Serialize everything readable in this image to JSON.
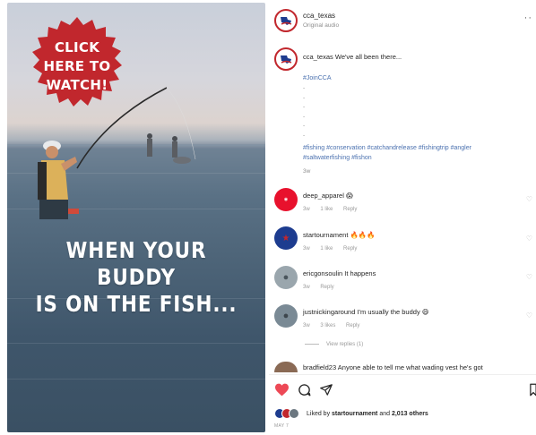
{
  "post": {
    "account": "cca_texas",
    "audio": "Original audio",
    "caption_user": "cca_texas",
    "caption_text": "We've all been there...",
    "hashtag_join": "#JoinCCA",
    "caption_dots": [
      "-",
      "-",
      "-",
      "-",
      "-",
      "-"
    ],
    "hashtags_line1": "#fishing #conservation #catchandrelease #fishingtrip #angler",
    "hashtags_line2": "#saltwaterfishing #fishon",
    "caption_age": "3w"
  },
  "media": {
    "badge_text": [
      "CLICK",
      "HERE TO",
      "WATCH!"
    ],
    "overlay_text": [
      "WHEN YOUR BUDDY",
      "IS ON THE FISH..."
    ],
    "badge_color": "#c1272d"
  },
  "comments": [
    {
      "user": "deep_apparel",
      "text": "😱",
      "age": "3w",
      "likes": "1 like",
      "reply": "Reply",
      "avatar_color": "#e8112d"
    },
    {
      "user": "startournament",
      "text": "🔥🔥🔥",
      "age": "3w",
      "likes": "1 like",
      "reply": "Reply",
      "avatar_color": "#1d3c8f"
    },
    {
      "user": "ericgonsoulin",
      "text": "It happens",
      "age": "3w",
      "likes": "",
      "reply": "Reply",
      "avatar_color": "#9aa6ad"
    },
    {
      "user": "justnickingaround",
      "text": "I'm usually the buddy 😄",
      "age": "3w",
      "likes": "3 likes",
      "reply": "Reply",
      "view_replies": "View replies (1)",
      "avatar_color": "#7a8a95"
    },
    {
      "user": "bradfield23",
      "text": "Anyone able to tell me what wading vest he's got",
      "avatar_color": "#8a6a55"
    }
  ],
  "likes": {
    "prefix": "Liked by",
    "user": "startournament",
    "middle": "and",
    "count": "2,013 others",
    "date": "MAY 7"
  },
  "colors": {
    "heart": "#ed4956",
    "link": "#4c72b0",
    "muted": "#8e8e8e"
  }
}
